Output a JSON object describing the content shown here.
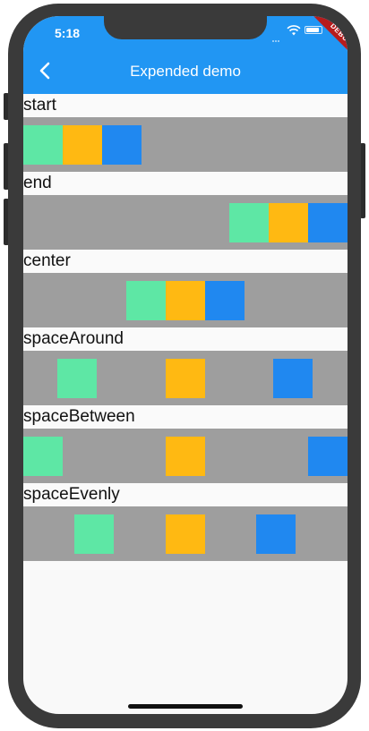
{
  "status_bar": {
    "time": "5:18"
  },
  "debug_banner": "DEBUG",
  "app_bar": {
    "title": "Expended demo",
    "back_icon": "chevron-left-icon"
  },
  "colors": {
    "app_bar": "#2196f3",
    "band": "#9e9e9e",
    "green": "#5ee7a5",
    "amber": "#ffb912",
    "blue": "#2088f0"
  },
  "sections": [
    {
      "label": "start"
    },
    {
      "label": "end"
    },
    {
      "label": "center"
    },
    {
      "label": "spaceAround"
    },
    {
      "label": "spaceBetween"
    },
    {
      "label": "spaceEvenly"
    }
  ]
}
